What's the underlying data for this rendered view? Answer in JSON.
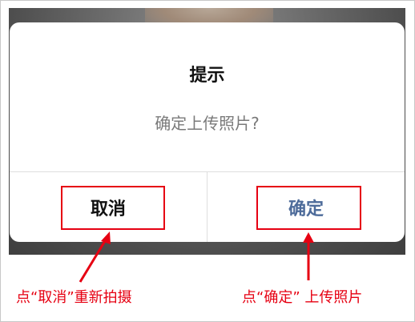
{
  "dialog": {
    "title": "提示",
    "message": "确定上传照片?",
    "cancel_label": "取消",
    "confirm_label": "确定"
  },
  "annotations": {
    "left_caption": "点“取消”重新拍摄",
    "right_caption": "点“确定” 上传照片"
  },
  "colors": {
    "accent_red": "#e60012",
    "confirm_blue": "#4d6b9a",
    "title_text": "#111111",
    "message_text": "#7a7a7a"
  }
}
